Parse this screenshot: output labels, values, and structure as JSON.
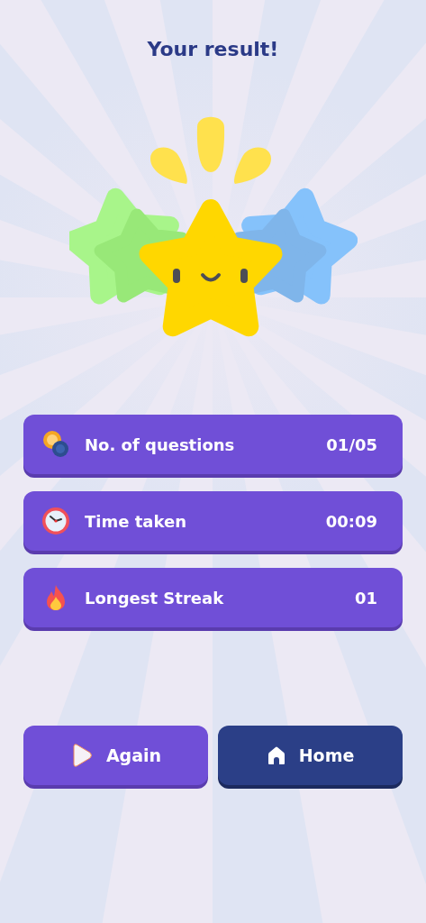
{
  "title": "Your result!",
  "stats": [
    {
      "kind": "questions",
      "label": "No. of questions",
      "value": "01/05"
    },
    {
      "kind": "time",
      "label": "Time taken",
      "value": "00:09"
    },
    {
      "kind": "streak",
      "label": "Longest Streak",
      "value": "01"
    }
  ],
  "buttons": [
    {
      "kind": "again",
      "label": "Again"
    },
    {
      "kind": "home",
      "label": "Home"
    }
  ]
}
